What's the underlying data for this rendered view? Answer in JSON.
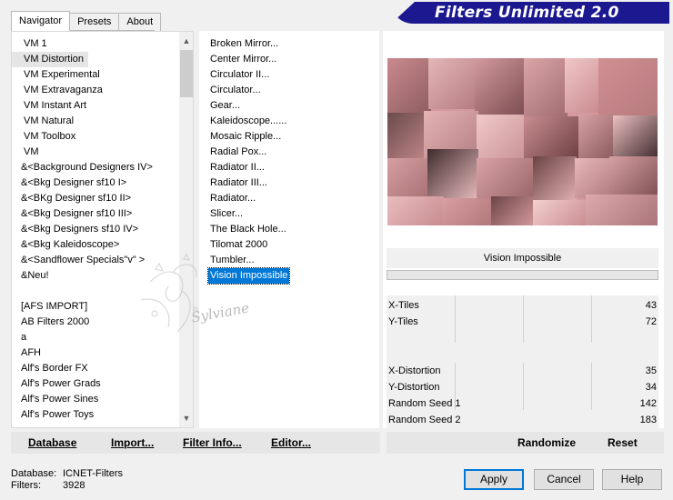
{
  "tabs": [
    {
      "label": "Navigator",
      "active": true
    },
    {
      "label": "Presets",
      "active": false
    },
    {
      "label": "About",
      "active": false
    }
  ],
  "banner": {
    "title": "Filters Unlimited 2.0",
    "color": "#1c1890"
  },
  "categories": [
    "VM 1",
    "VM Distortion",
    "VM Experimental",
    "VM Extravaganza",
    "VM Instant Art",
    "VM Natural",
    "VM Toolbox",
    "VM",
    "&<Background Designers IV>",
    "&<Bkg Designer sf10 I>",
    "&<BKg Designer sf10 II>",
    "&<Bkg Designer sf10 III>",
    "&<Bkg Designers sf10 IV>",
    "&<Bkg Kaleidoscope>",
    "&<Sandflower Specials\"v\" >",
    "&Neu!",
    "",
    "[AFS IMPORT]",
    "AB Filters 2000",
    "a",
    "AFH",
    "Alf's Border FX",
    "Alf's Power Grads",
    "Alf's Power Sines",
    "Alf's Power Toys"
  ],
  "selected_category": "VM Distortion",
  "filters": [
    "Broken Mirror...",
    "Center Mirror...",
    "Circulator II...",
    "Circulator...",
    "Gear...",
    "Kaleidoscope......",
    "Mosaic Ripple...",
    "Radial Pox...",
    "Radiator II...",
    "Radiator III...",
    "Radiator...",
    "Slicer...",
    "The Black Hole...",
    "Tilomat 2000",
    "Tumbler...",
    "Vision Impossible"
  ],
  "selected_filter": "Vision Impossible",
  "watermark": "Sylviane",
  "preview": {
    "filter_name": "Vision Impossible",
    "base_color": "#d4999c"
  },
  "params": [
    {
      "label": "X-Tiles",
      "value": "43"
    },
    {
      "label": "Y-Tiles",
      "value": "72"
    },
    {
      "label": "X-Distortion",
      "value": "35"
    },
    {
      "label": "Y-Distortion",
      "value": "34"
    },
    {
      "label": "Random Seed 1",
      "value": "142"
    },
    {
      "label": "Random Seed 2",
      "value": "183"
    }
  ],
  "bottom_buttons": {
    "database": "Database",
    "import": "Import...",
    "filter_info": "Filter Info...",
    "editor": "Editor...",
    "randomize": "Randomize",
    "reset": "Reset"
  },
  "status": {
    "database_label": "Database:",
    "database_value": "ICNET-Filters",
    "filters_label": "Filters:",
    "filters_value": "3928"
  },
  "dialog_buttons": {
    "apply": "Apply",
    "cancel": "Cancel",
    "help": "Help"
  }
}
